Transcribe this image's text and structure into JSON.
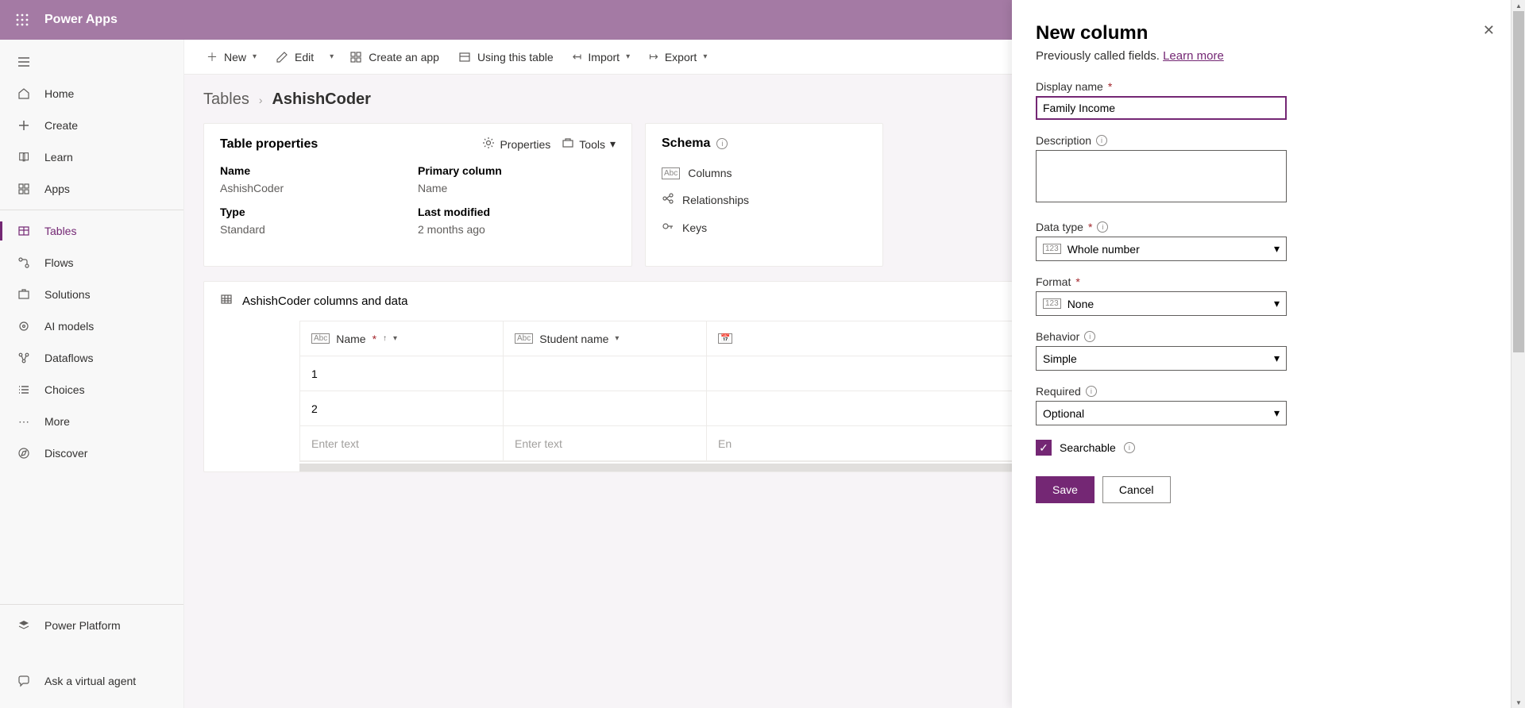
{
  "header": {
    "brand": "Power Apps"
  },
  "sidebar": {
    "items": [
      {
        "label": "Home"
      },
      {
        "label": "Create"
      },
      {
        "label": "Learn"
      },
      {
        "label": "Apps"
      },
      {
        "label": "Tables"
      },
      {
        "label": "Flows"
      },
      {
        "label": "Solutions"
      },
      {
        "label": "AI models"
      },
      {
        "label": "Dataflows"
      },
      {
        "label": "Choices"
      },
      {
        "label": "More"
      },
      {
        "label": "Discover"
      }
    ],
    "footer": {
      "platform": "Power Platform",
      "ask": "Ask a virtual agent"
    }
  },
  "cmdbar": {
    "new": "New",
    "edit": "Edit",
    "createApp": "Create an app",
    "useTable": "Using this table",
    "import": "Import",
    "export": "Export"
  },
  "breadcrumb": {
    "root": "Tables",
    "current": "AshishCoder"
  },
  "props": {
    "title": "Table properties",
    "propsLink": "Properties",
    "toolsLink": "Tools",
    "nameLabel": "Name",
    "nameValue": "AshishCoder",
    "typeLabel": "Type",
    "typeValue": "Standard",
    "pcolLabel": "Primary column",
    "pcolValue": "Name",
    "lmLabel": "Last modified",
    "lmValue": "2 months ago"
  },
  "schema": {
    "title": "Schema",
    "columns": "Columns",
    "rel": "Relationships",
    "keys": "Keys"
  },
  "dataCard": {
    "title": "AshishCoder columns and data",
    "colName": "Name",
    "colStudent": "Student name",
    "row1": "1",
    "row2": "2",
    "enter": "Enter text",
    "enPartial": "En"
  },
  "panel": {
    "title": "New column",
    "sub1": "Previously called fields.",
    "learn": "Learn more",
    "displayLabel": "Display name",
    "displayValue": "Family Income",
    "descLabel": "Description",
    "dtLabel": "Data type",
    "dtValue": "Whole number",
    "fmtLabel": "Format",
    "fmtValue": "None",
    "behLabel": "Behavior",
    "behValue": "Simple",
    "reqLabel": "Required",
    "reqValue": "Optional",
    "searchable": "Searchable",
    "save": "Save",
    "cancel": "Cancel"
  }
}
